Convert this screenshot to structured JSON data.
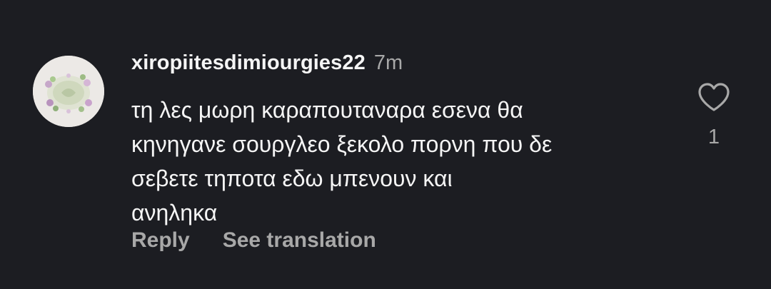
{
  "comment": {
    "username": "xiropiitesdimiourgies22",
    "time": "7m",
    "text_lines": [
      "τη λες μωρη καραπουταναρα εσενα θα",
      "κηνηγανε σουργλεο ξεκολο πορνη που δε",
      "σεβετε τηποτα εδω μπενουν και",
      "ανηληκα"
    ],
    "actions": {
      "reply": "Reply",
      "see_translation": "See translation"
    },
    "likes": {
      "icon": "heart-icon",
      "count": "1"
    }
  },
  "colors": {
    "background": "#1c1d22",
    "primary_text": "#f5f5f5",
    "secondary_text": "#a8a8a8"
  }
}
